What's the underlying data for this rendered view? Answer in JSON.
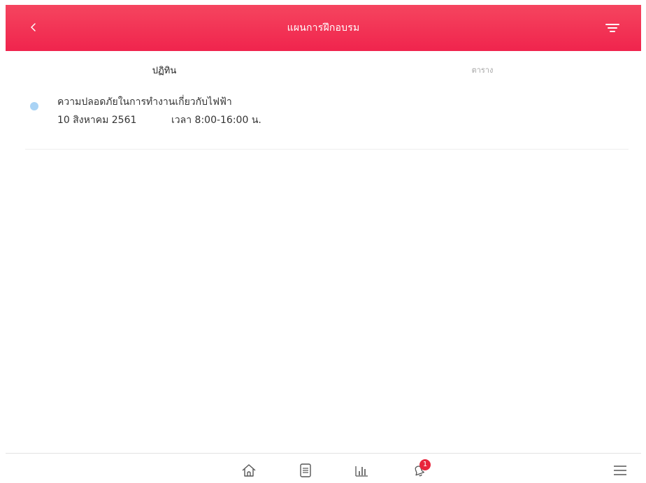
{
  "header": {
    "title": "แผนการฝึกอบรม",
    "back_icon": "chevron-left-icon",
    "filter_icon": "filter-icon",
    "color": "#f0244d"
  },
  "tabs": [
    {
      "label": "ปฏิทิน",
      "active": true
    },
    {
      "label": "ตาราง",
      "active": false
    }
  ],
  "training_list": [
    {
      "title": "ความปลอดภัยในการทำงานเกี่ยวกับไฟฟ้า",
      "date": "10 สิงหาคม 2561",
      "time": "เวลา 8:00-16:00 น.",
      "dot_color": "#a9d3f5"
    }
  ],
  "bottom_nav": {
    "items": [
      {
        "icon": "home-icon"
      },
      {
        "icon": "document-icon"
      },
      {
        "icon": "bar-chart-icon"
      },
      {
        "icon": "bell-icon",
        "badge": "1"
      }
    ],
    "menu_icon": "hamburger-menu-icon"
  }
}
